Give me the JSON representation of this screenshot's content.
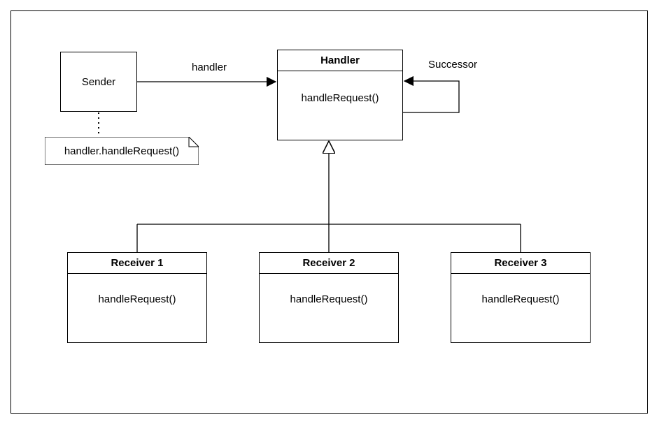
{
  "sender": {
    "title": "Sender"
  },
  "handler": {
    "title": "Handler",
    "method": "handleRequest()",
    "assocLabel": "handler",
    "selfLabel": "Successor"
  },
  "note": {
    "text": "handler.handleRequest()"
  },
  "receivers": [
    {
      "title": "Receiver 1",
      "method": "handleRequest()"
    },
    {
      "title": "Receiver 2",
      "method": "handleRequest()"
    },
    {
      "title": "Receiver 3",
      "method": "handleRequest()"
    }
  ]
}
